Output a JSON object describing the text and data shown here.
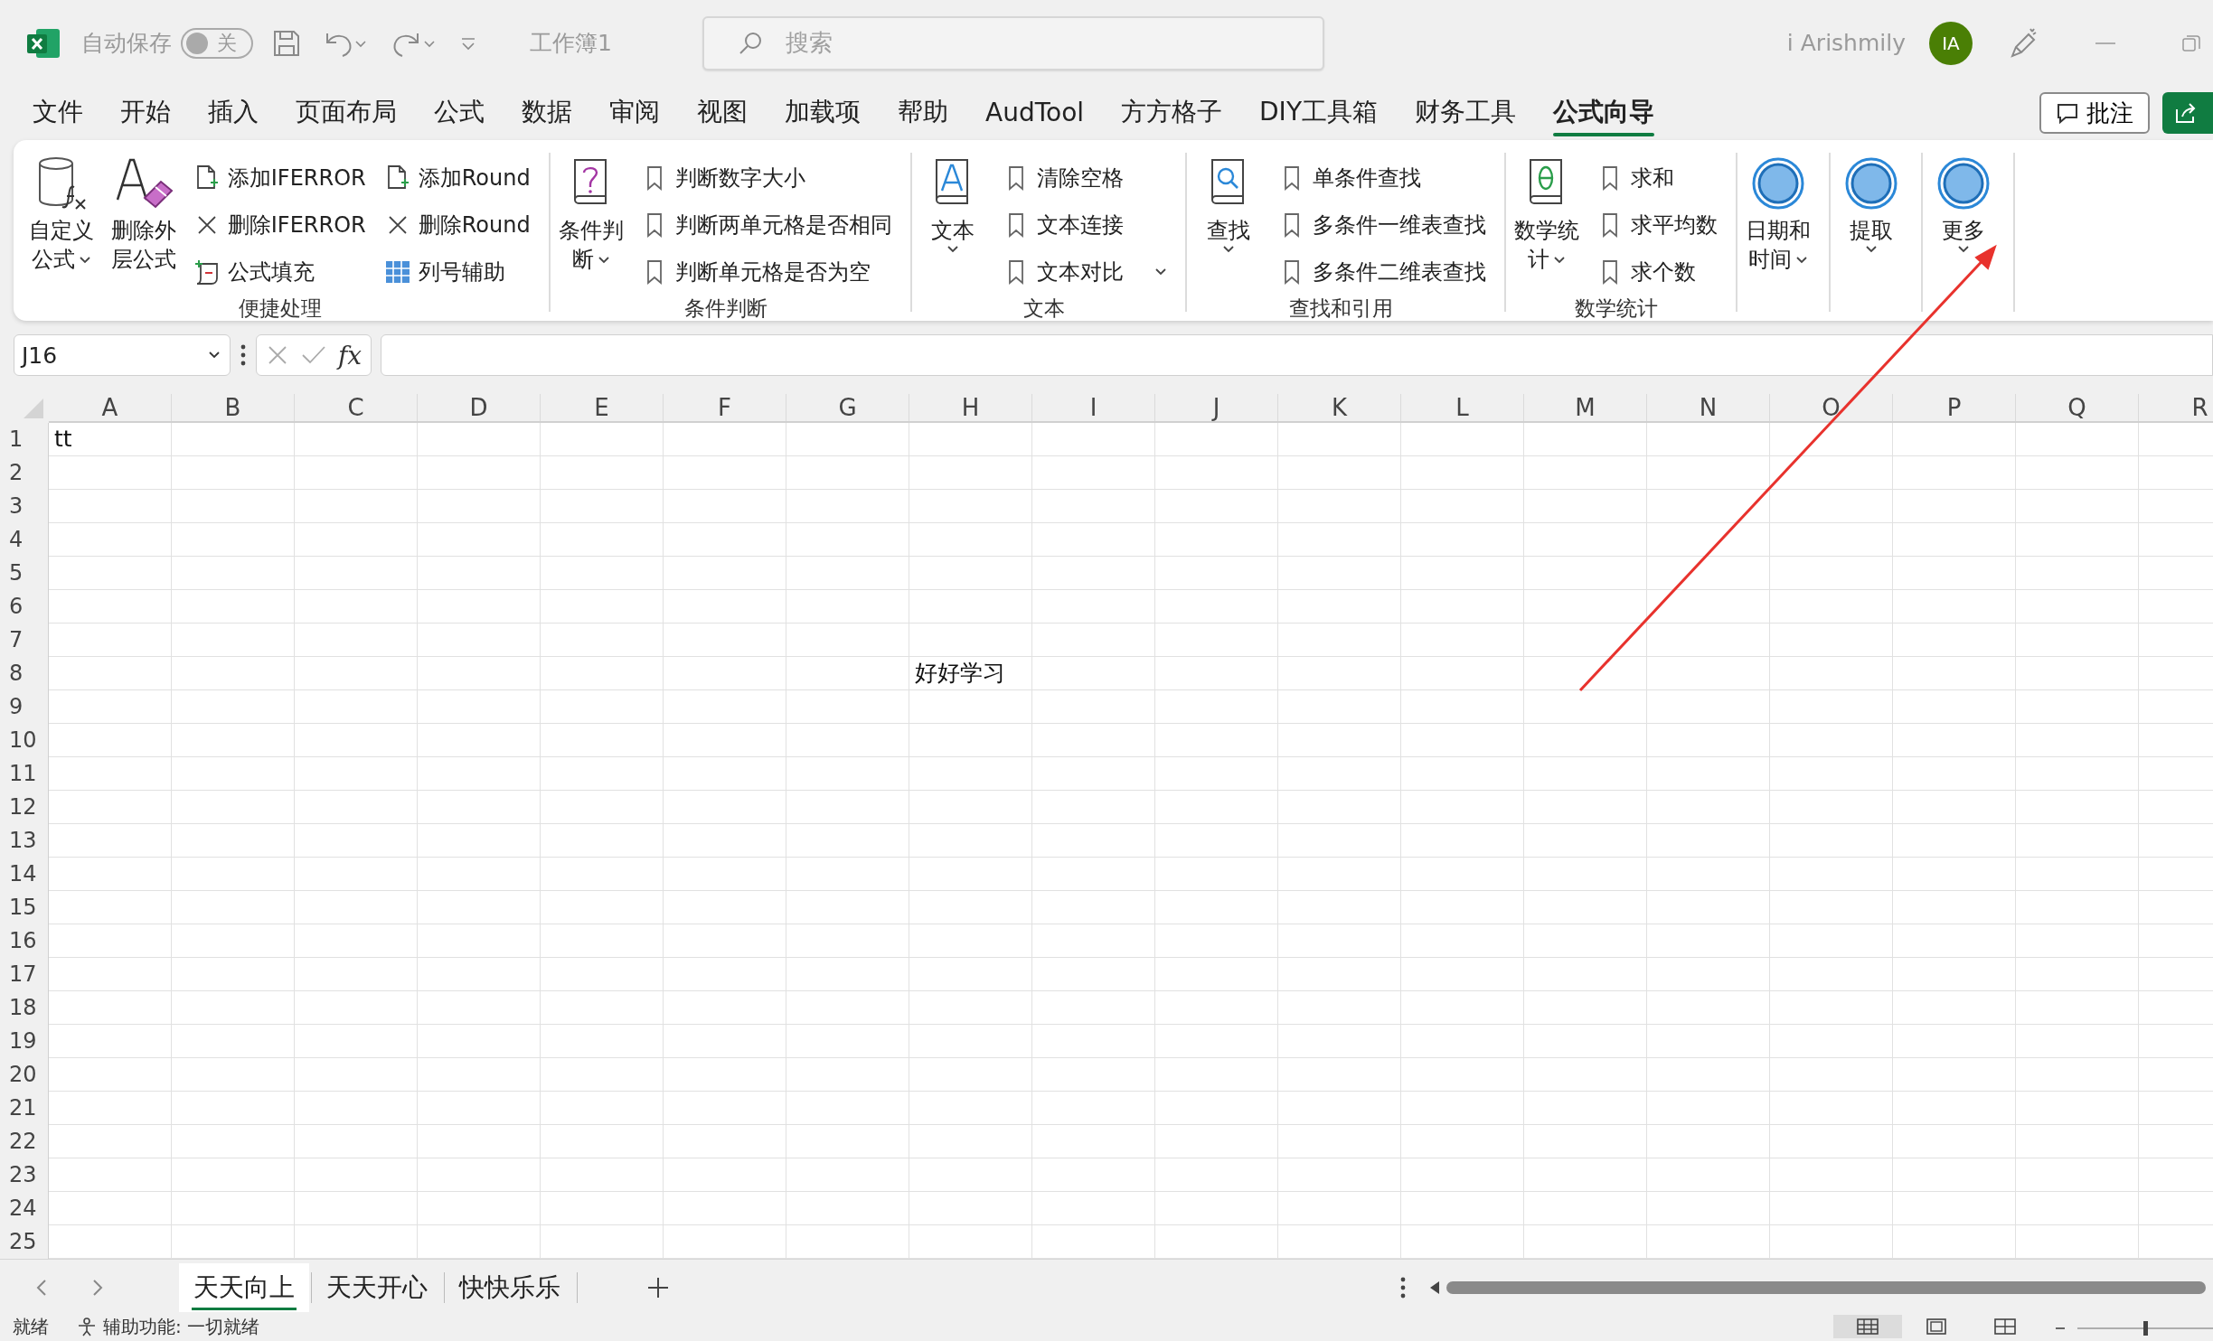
{
  "title_bar": {
    "autosave_label": "自动保存",
    "autosave_toggle": {
      "on": false,
      "label": "关"
    },
    "workbook_name": "工作簿1",
    "search": {
      "placeholder": "搜索"
    },
    "user_name": "i Arishmily",
    "avatar_initials": "IA"
  },
  "menu_tabs": [
    {
      "label": "文件",
      "selected": false
    },
    {
      "label": "开始",
      "selected": false
    },
    {
      "label": "插入",
      "selected": false
    },
    {
      "label": "页面布局",
      "selected": false
    },
    {
      "label": "公式",
      "selected": false
    },
    {
      "label": "数据",
      "selected": false
    },
    {
      "label": "审阅",
      "selected": false
    },
    {
      "label": "视图",
      "selected": false
    },
    {
      "label": "加载项",
      "selected": false
    },
    {
      "label": "帮助",
      "selected": false
    },
    {
      "label": "AudTool",
      "selected": false
    },
    {
      "label": "方方格子",
      "selected": false
    },
    {
      "label": "DIY工具箱",
      "selected": false
    },
    {
      "label": "财务工具",
      "selected": false
    },
    {
      "label": "公式向导",
      "selected": true
    }
  ],
  "comments_button": "批注",
  "ribbon": {
    "groups": [
      {
        "label": "便捷处理",
        "items": [
          {
            "kind": "large",
            "label": "自定义公式",
            "dropdown": true
          },
          {
            "kind": "large",
            "label": "删除外层公式",
            "dropdown": false
          },
          {
            "kind": "column",
            "items": [
              {
                "label": "添加IFERROR",
                "dropdown": false
              },
              {
                "label": "删除IFERROR",
                "dropdown": false
              },
              {
                "label": "公式填充",
                "dropdown": false
              }
            ]
          },
          {
            "kind": "column",
            "items": [
              {
                "label": "添加Round",
                "dropdown": false
              },
              {
                "label": "删除Round",
                "dropdown": false
              },
              {
                "label": "列号辅助",
                "dropdown": false
              }
            ]
          }
        ]
      },
      {
        "label": "条件判断",
        "items": [
          {
            "kind": "large",
            "label": "条件判断",
            "dropdown": true
          },
          {
            "kind": "column",
            "items": [
              {
                "label": "判断数字大小",
                "dropdown": false
              },
              {
                "label": "判断两单元格是否相同",
                "dropdown": false
              },
              {
                "label": "判断单元格是否为空",
                "dropdown": false
              }
            ]
          }
        ]
      },
      {
        "label": "文本",
        "items": [
          {
            "kind": "large",
            "label": "文本",
            "dropdown": true
          },
          {
            "kind": "column",
            "items": [
              {
                "label": "清除空格",
                "dropdown": false
              },
              {
                "label": "文本连接",
                "dropdown": false
              },
              {
                "label": "文本对比",
                "dropdown": true
              }
            ]
          }
        ]
      },
      {
        "label": "查找和引用",
        "items": [
          {
            "kind": "large",
            "label": "查找",
            "dropdown": true
          },
          {
            "kind": "column",
            "items": [
              {
                "label": "单条件查找",
                "dropdown": false
              },
              {
                "label": "多条件一维表查找",
                "dropdown": false
              },
              {
                "label": "多条件二维表查找",
                "dropdown": false
              }
            ]
          }
        ]
      },
      {
        "label": "数学统计",
        "items": [
          {
            "kind": "large",
            "label": "数学统计",
            "dropdown": true
          },
          {
            "kind": "column",
            "items": [
              {
                "label": "求和",
                "dropdown": false
              },
              {
                "label": "求平均数",
                "dropdown": false
              },
              {
                "label": "求个数",
                "dropdown": false
              }
            ]
          }
        ]
      },
      {
        "items": [
          {
            "kind": "large",
            "label": "日期和时间",
            "dropdown": true
          }
        ]
      },
      {
        "items": [
          {
            "kind": "large",
            "label": "提取",
            "dropdown": true
          }
        ]
      },
      {
        "items": [
          {
            "kind": "large",
            "label": "更多",
            "dropdown": true
          }
        ]
      }
    ]
  },
  "formula_bar": {
    "name_box": "J16",
    "function_button": "fx"
  },
  "sheet": {
    "columns": [
      "A",
      "B",
      "C",
      "D",
      "E",
      "F",
      "G",
      "H",
      "I",
      "J",
      "K",
      "L",
      "M",
      "N",
      "O",
      "P",
      "Q",
      "R"
    ],
    "rows": [
      {
        "header": "1",
        "cells": {
          "A": "tt"
        }
      },
      {
        "header": "2"
      },
      {
        "header": "3"
      },
      {
        "header": "4"
      },
      {
        "header": "5"
      },
      {
        "header": "6"
      },
      {
        "header": "7"
      },
      {
        "header": "8",
        "cells": {
          "H": "好好学习"
        }
      },
      {
        "header": "9"
      },
      {
        "header": "10"
      },
      {
        "header": "11"
      },
      {
        "header": "12"
      },
      {
        "header": "13"
      },
      {
        "header": "14"
      },
      {
        "header": "15"
      },
      {
        "header": "16"
      },
      {
        "header": "17"
      },
      {
        "header": "18"
      },
      {
        "header": "19"
      },
      {
        "header": "20"
      },
      {
        "header": "21"
      },
      {
        "header": "22"
      },
      {
        "header": "23"
      },
      {
        "header": "24"
      },
      {
        "header": "25"
      }
    ]
  },
  "sheet_tabs": [
    {
      "label": "天天向上",
      "selected": true
    },
    {
      "label": "天天开心",
      "selected": false
    },
    {
      "label": "快快乐乐",
      "selected": false
    }
  ],
  "status_bar": {
    "ready": "就绪",
    "accessibility": "辅助功能: 一切就绪",
    "zoom_slider": {
      "level": 0.5
    }
  }
}
